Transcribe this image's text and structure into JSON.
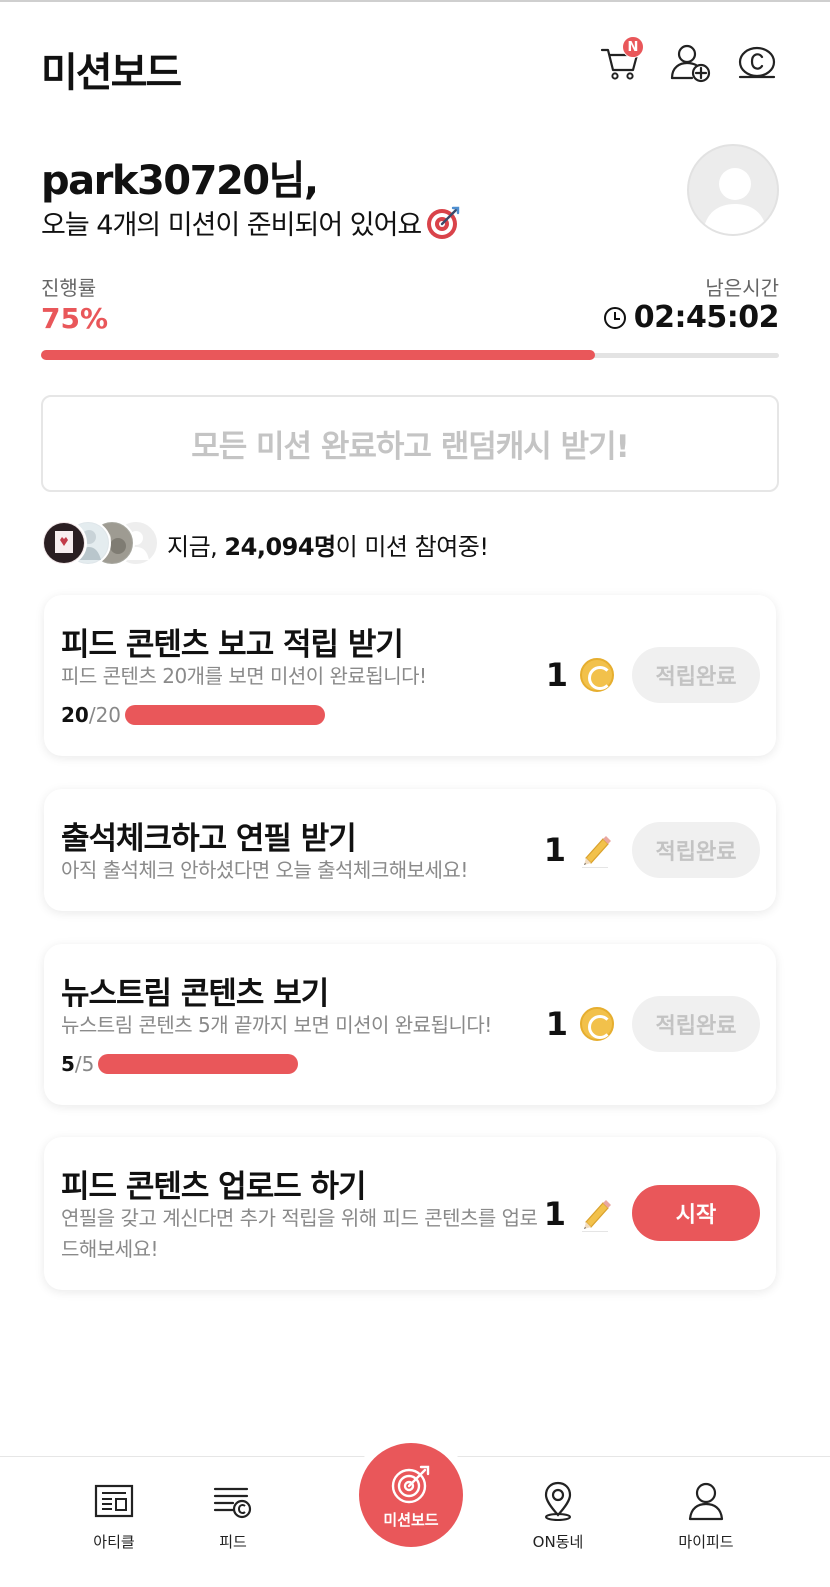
{
  "header": {
    "title": "미션보드",
    "cart_badge": "N",
    "icons": [
      "cart-icon",
      "add-friend-icon",
      "cash-coin-icon"
    ]
  },
  "greeting": {
    "name": "park30720님,",
    "message": "오늘 4개의 미션이 준비되어 있어요"
  },
  "progress": {
    "label": "진행률",
    "value_text": "75%",
    "fraction": 0.75,
    "time_label": "남은시간",
    "time_value": "02:45:02"
  },
  "banner": {
    "text": "모든 미션 완료하고 랜덤캐시 받기!"
  },
  "participants": {
    "prefix": "지금, ",
    "count": "24,094명",
    "suffix": "이 미션 참여중!"
  },
  "missions": [
    {
      "title": "피드 콘텐츠 보고 적립 받기",
      "desc": "피드 콘텐츠 20개를 보면 미션이 완료됩니다!",
      "progress_current": "20",
      "progress_total": "/20",
      "progress_fraction": 1.0,
      "reward": "1",
      "reward_icon": "coin-icon",
      "button": "적립완료"
    },
    {
      "title": "출석체크하고 연필 받기",
      "desc": "아직 출석체크 안하셨다면 오늘 출석체크해보세요!",
      "reward": "1",
      "reward_icon": "pencil-icon",
      "button": "적립완료"
    },
    {
      "title": "뉴스트림 콘텐츠 보기",
      "desc": "뉴스트림 콘텐츠 5개 끝까지 보면 미션이 완료됩니다!",
      "progress_current": "5",
      "progress_total": "/5",
      "progress_fraction": 1.0,
      "reward": "1",
      "reward_icon": "coin-icon",
      "button": "적립완료"
    },
    {
      "title": "피드 콘텐츠 업로드 하기",
      "desc": "연필을 갖고 계신다면 추가 적립을 위해 피드 콘텐츠를 업로드해보세요!",
      "reward": "1",
      "reward_icon": "pencil-icon",
      "button": "시작"
    }
  ],
  "bottom_nav": {
    "items": [
      {
        "label": "아티클",
        "icon": "article-icon"
      },
      {
        "label": "피드",
        "icon": "feed-icon"
      },
      {
        "label": "미션보드",
        "icon": "target-icon"
      },
      {
        "label": "ON동네",
        "icon": "location-pin-icon"
      },
      {
        "label": "마이피드",
        "icon": "profile-icon"
      }
    ]
  },
  "colors": {
    "accent": "#e9575a",
    "coin": "#f2c14b",
    "muted_text": "#8a8a8a",
    "disabled_button": "#f0f0f0"
  }
}
